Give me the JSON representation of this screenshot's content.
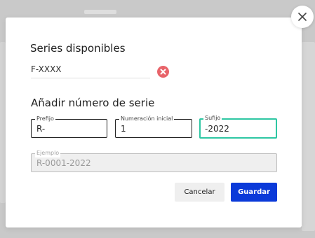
{
  "dialog": {
    "close_icon": "close-icon",
    "section_series": {
      "title": "Series disponibles",
      "items": [
        {
          "value": "F-XXXX",
          "remove_icon": "remove-circle-icon",
          "remove_color": "#e8646a"
        }
      ]
    },
    "section_add": {
      "title": "Añadir número de serie",
      "prefix": {
        "label": "Prefijo",
        "value": "R-"
      },
      "start_number": {
        "label": "Numeración inicial",
        "value": "1"
      },
      "suffix": {
        "label": "Sufijo",
        "value": "-2022"
      },
      "example": {
        "label": "Ejemplo",
        "value": "R-0001-2022"
      }
    },
    "buttons": {
      "cancel_label": "Cancelar",
      "save_label": "Guardar"
    }
  },
  "colors": {
    "accent": "#2ec7a3",
    "primary_button": "#0b3ad9",
    "danger": "#e8646a"
  }
}
